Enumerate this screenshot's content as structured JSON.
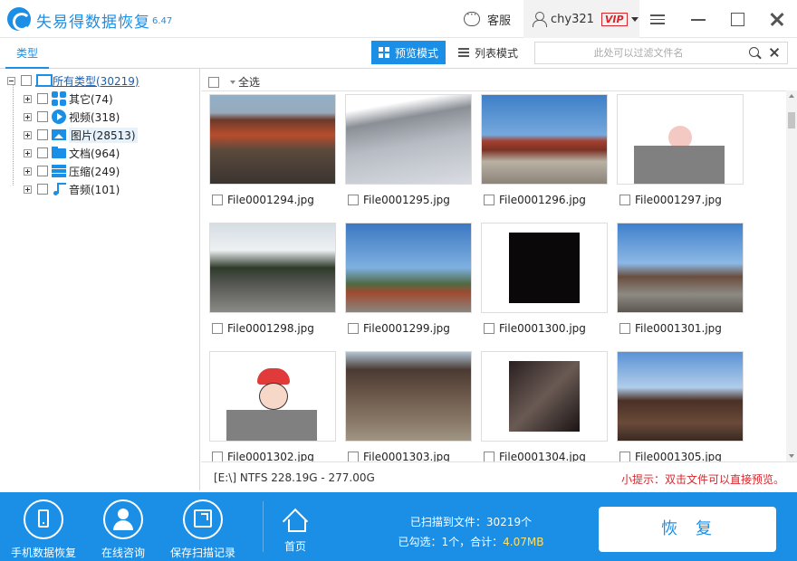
{
  "app": {
    "title": "失易得数据恢复",
    "version": "6.47"
  },
  "titlebar": {
    "service_label": "客服",
    "username": "chy321",
    "vip_label": "VIP"
  },
  "toolbar": {
    "type_tab": "类型",
    "preview_mode": "预览模式",
    "list_mode": "列表模式",
    "filter_placeholder": "此处可以过滤文件名"
  },
  "tree": {
    "root": "所有类型(30219)",
    "items": [
      {
        "label": "其它(74)",
        "icon": "apps-icon"
      },
      {
        "label": "视频(318)",
        "icon": "video-icon"
      },
      {
        "label": "图片(28513)",
        "icon": "picture-icon"
      },
      {
        "label": "文档(964)",
        "icon": "folder-icon"
      },
      {
        "label": "压缩(249)",
        "icon": "archive-icon"
      },
      {
        "label": "音频(101)",
        "icon": "music-icon"
      }
    ]
  },
  "grid": {
    "select_all": "全选",
    "files": [
      "File0001294.jpg",
      "File0001295.jpg",
      "File0001296.jpg",
      "File0001297.jpg",
      "File0001298.jpg",
      "File0001299.jpg",
      "File0001300.jpg",
      "File0001301.jpg",
      "File0001302.jpg",
      "File0001303.jpg",
      "File0001304.jpg",
      "File0001305.jpg"
    ]
  },
  "status": {
    "disk": "[E:\\] NTFS 228.19G - 277.00G",
    "hint": "小提示：双击文件可以直接预览。"
  },
  "footer": {
    "phone_recovery": "手机数据恢复",
    "online_consult": "在线咨询",
    "save_scan": "保存扫描记录",
    "home": "首页",
    "scanned_label": "已扫描到文件：",
    "scanned_count": "30219个",
    "selected_label": "已勾选：1个，合计：",
    "selected_size": "4.07MB",
    "recover_button": "恢复"
  },
  "colors": {
    "accent": "#1b8fe6",
    "vip": "#d9262c"
  }
}
